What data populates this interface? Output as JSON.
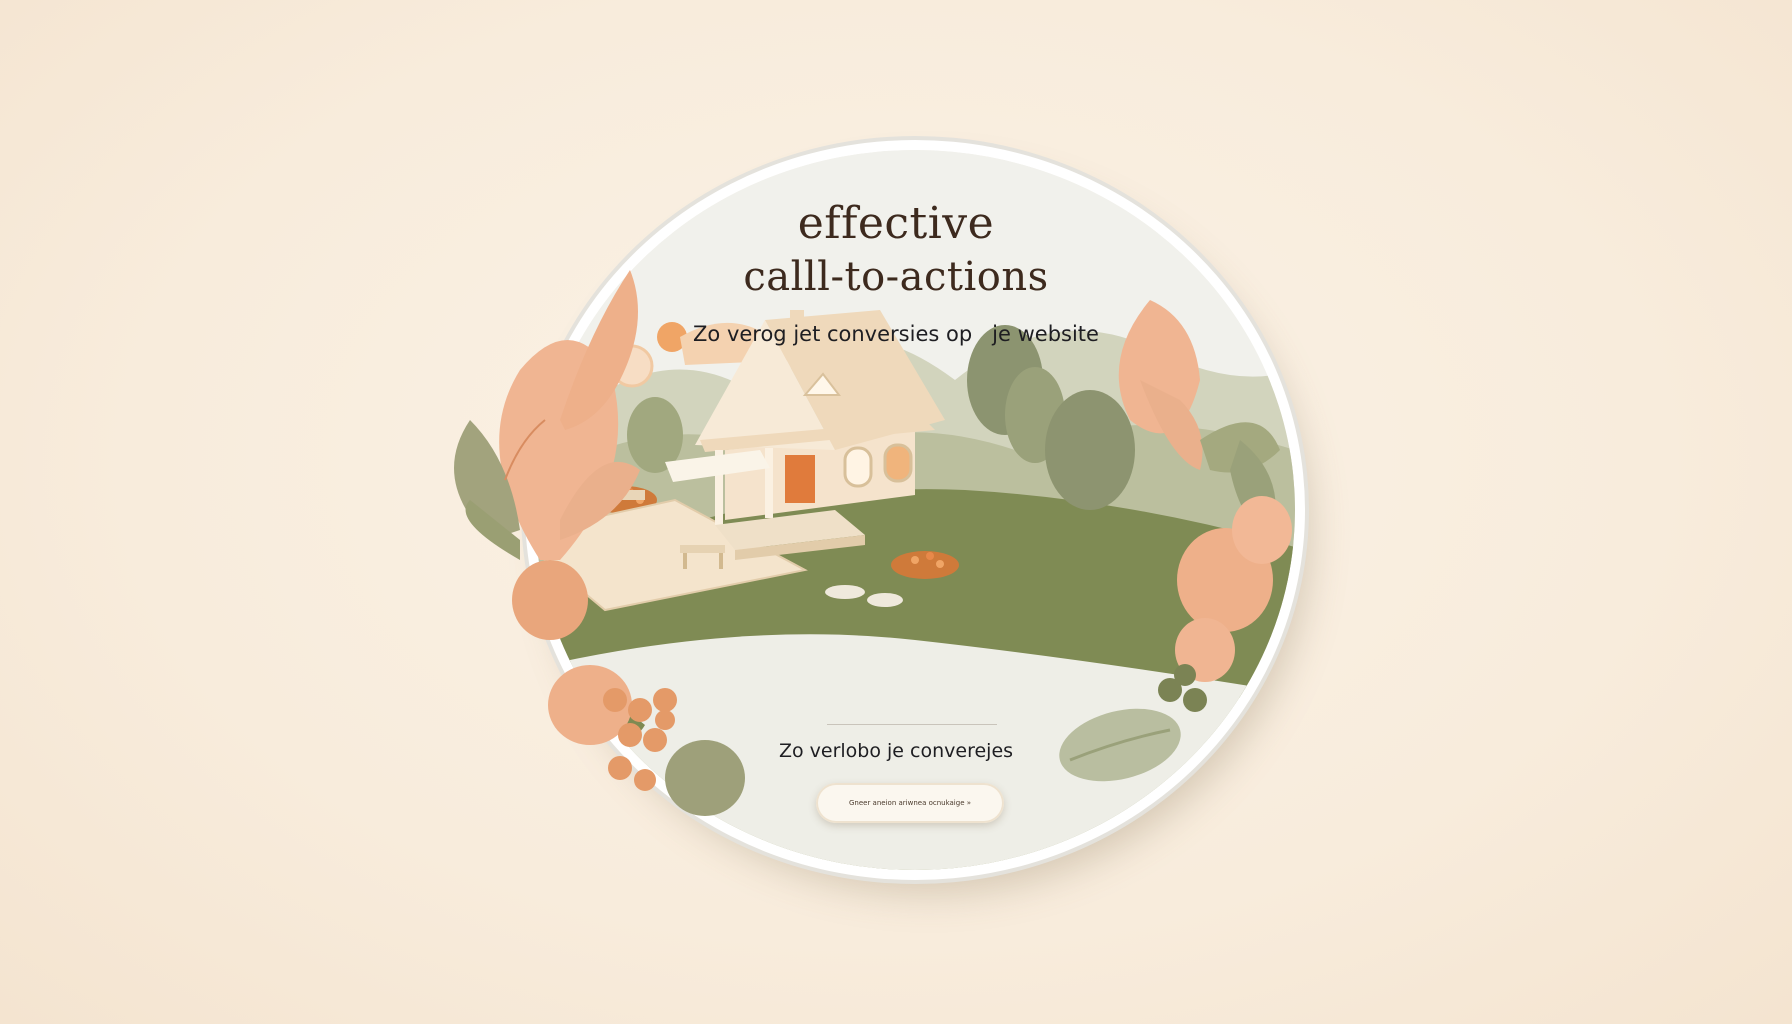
{
  "hero": {
    "title_line1": "effective",
    "title_line2": "calll-to-actions",
    "subtitle": "Zo verog jet conversies op   je website",
    "tagline": "Zo verlobo je converejes",
    "cta_label": "Gneer aneion ariwnea ocnukaige »"
  },
  "colors": {
    "background": "#f8ecdc",
    "badge": "#f2f0ea",
    "peach": "#eeb08a",
    "sage": "#9aa17a",
    "grass": "#7e8a52",
    "house": "#f5e3cc",
    "sun": "#f4d7b9",
    "orange_accent": "#e8894a",
    "text_dark": "#3d2a1e"
  },
  "icons": [
    "leaf-icon",
    "house-icon",
    "sun-icon",
    "berry-icon",
    "lounge-chair-icon"
  ]
}
